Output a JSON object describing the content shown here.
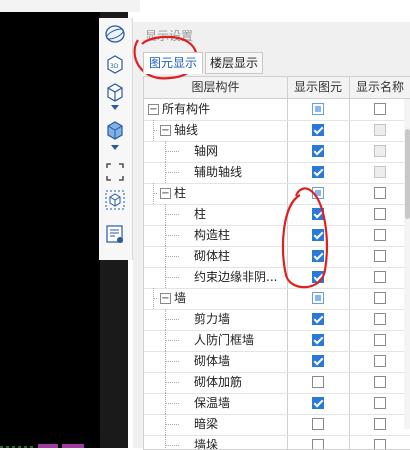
{
  "panel": {
    "title": "显示设置",
    "tabs": [
      {
        "label": "图元显示",
        "active": true
      },
      {
        "label": "楼层显示",
        "active": false
      }
    ],
    "columns": [
      "图层构件",
      "显示图元",
      "显示名称"
    ]
  },
  "toolbar_icons": [
    "sphere-icon",
    "3d-box-icon",
    "wireframe-cube-icon",
    "dropdown-arrow-icon",
    "solid-cube-icon",
    "dropdown-arrow-icon",
    "selection-frame-icon",
    "dashed-cube-icon",
    "view-settings-icon"
  ],
  "rows": [
    {
      "label": "所有构件",
      "level": 0,
      "expander": "−",
      "show_element": "partial",
      "show_name": "unchecked"
    },
    {
      "label": "轴线",
      "level": 1,
      "expander": "−",
      "show_element": "checked",
      "show_name": "disabled"
    },
    {
      "label": "轴网",
      "level": 2,
      "expander": "",
      "show_element": "checked",
      "show_name": "disabled"
    },
    {
      "label": "辅助轴线",
      "level": 2,
      "expander": "",
      "show_element": "checked",
      "show_name": "disabled"
    },
    {
      "label": "柱",
      "level": 1,
      "expander": "−",
      "show_element": "partial",
      "show_name": "unchecked"
    },
    {
      "label": "柱",
      "level": 2,
      "expander": "",
      "show_element": "checked",
      "show_name": "unchecked"
    },
    {
      "label": "构造柱",
      "level": 2,
      "expander": "",
      "show_element": "checked",
      "show_name": "unchecked"
    },
    {
      "label": "砌体柱",
      "level": 2,
      "expander": "",
      "show_element": "checked",
      "show_name": "unchecked"
    },
    {
      "label": "约束边缘非阴...",
      "level": 2,
      "expander": "",
      "show_element": "checked",
      "show_name": "unchecked"
    },
    {
      "label": "墙",
      "level": 1,
      "expander": "−",
      "show_element": "partial",
      "show_name": "unchecked"
    },
    {
      "label": "剪力墙",
      "level": 2,
      "expander": "",
      "show_element": "checked",
      "show_name": "unchecked"
    },
    {
      "label": "人防门框墙",
      "level": 2,
      "expander": "",
      "show_element": "checked",
      "show_name": "unchecked"
    },
    {
      "label": "砌体墙",
      "level": 2,
      "expander": "",
      "show_element": "checked",
      "show_name": "unchecked"
    },
    {
      "label": "砌体加筋",
      "level": 2,
      "expander": "",
      "show_element": "unchecked",
      "show_name": "unchecked"
    },
    {
      "label": "保温墙",
      "level": 2,
      "expander": "",
      "show_element": "checked",
      "show_name": "unchecked"
    },
    {
      "label": "暗梁",
      "level": 2,
      "expander": "",
      "show_element": "unchecked",
      "show_name": "unchecked"
    },
    {
      "label": "墙垛",
      "level": 2,
      "expander": "",
      "show_element": "unchecked",
      "show_name": "unchecked"
    }
  ],
  "colors": {
    "accent": "#2a78d8",
    "annotation": "#e02020",
    "tab_active_text": "#2060c0"
  }
}
